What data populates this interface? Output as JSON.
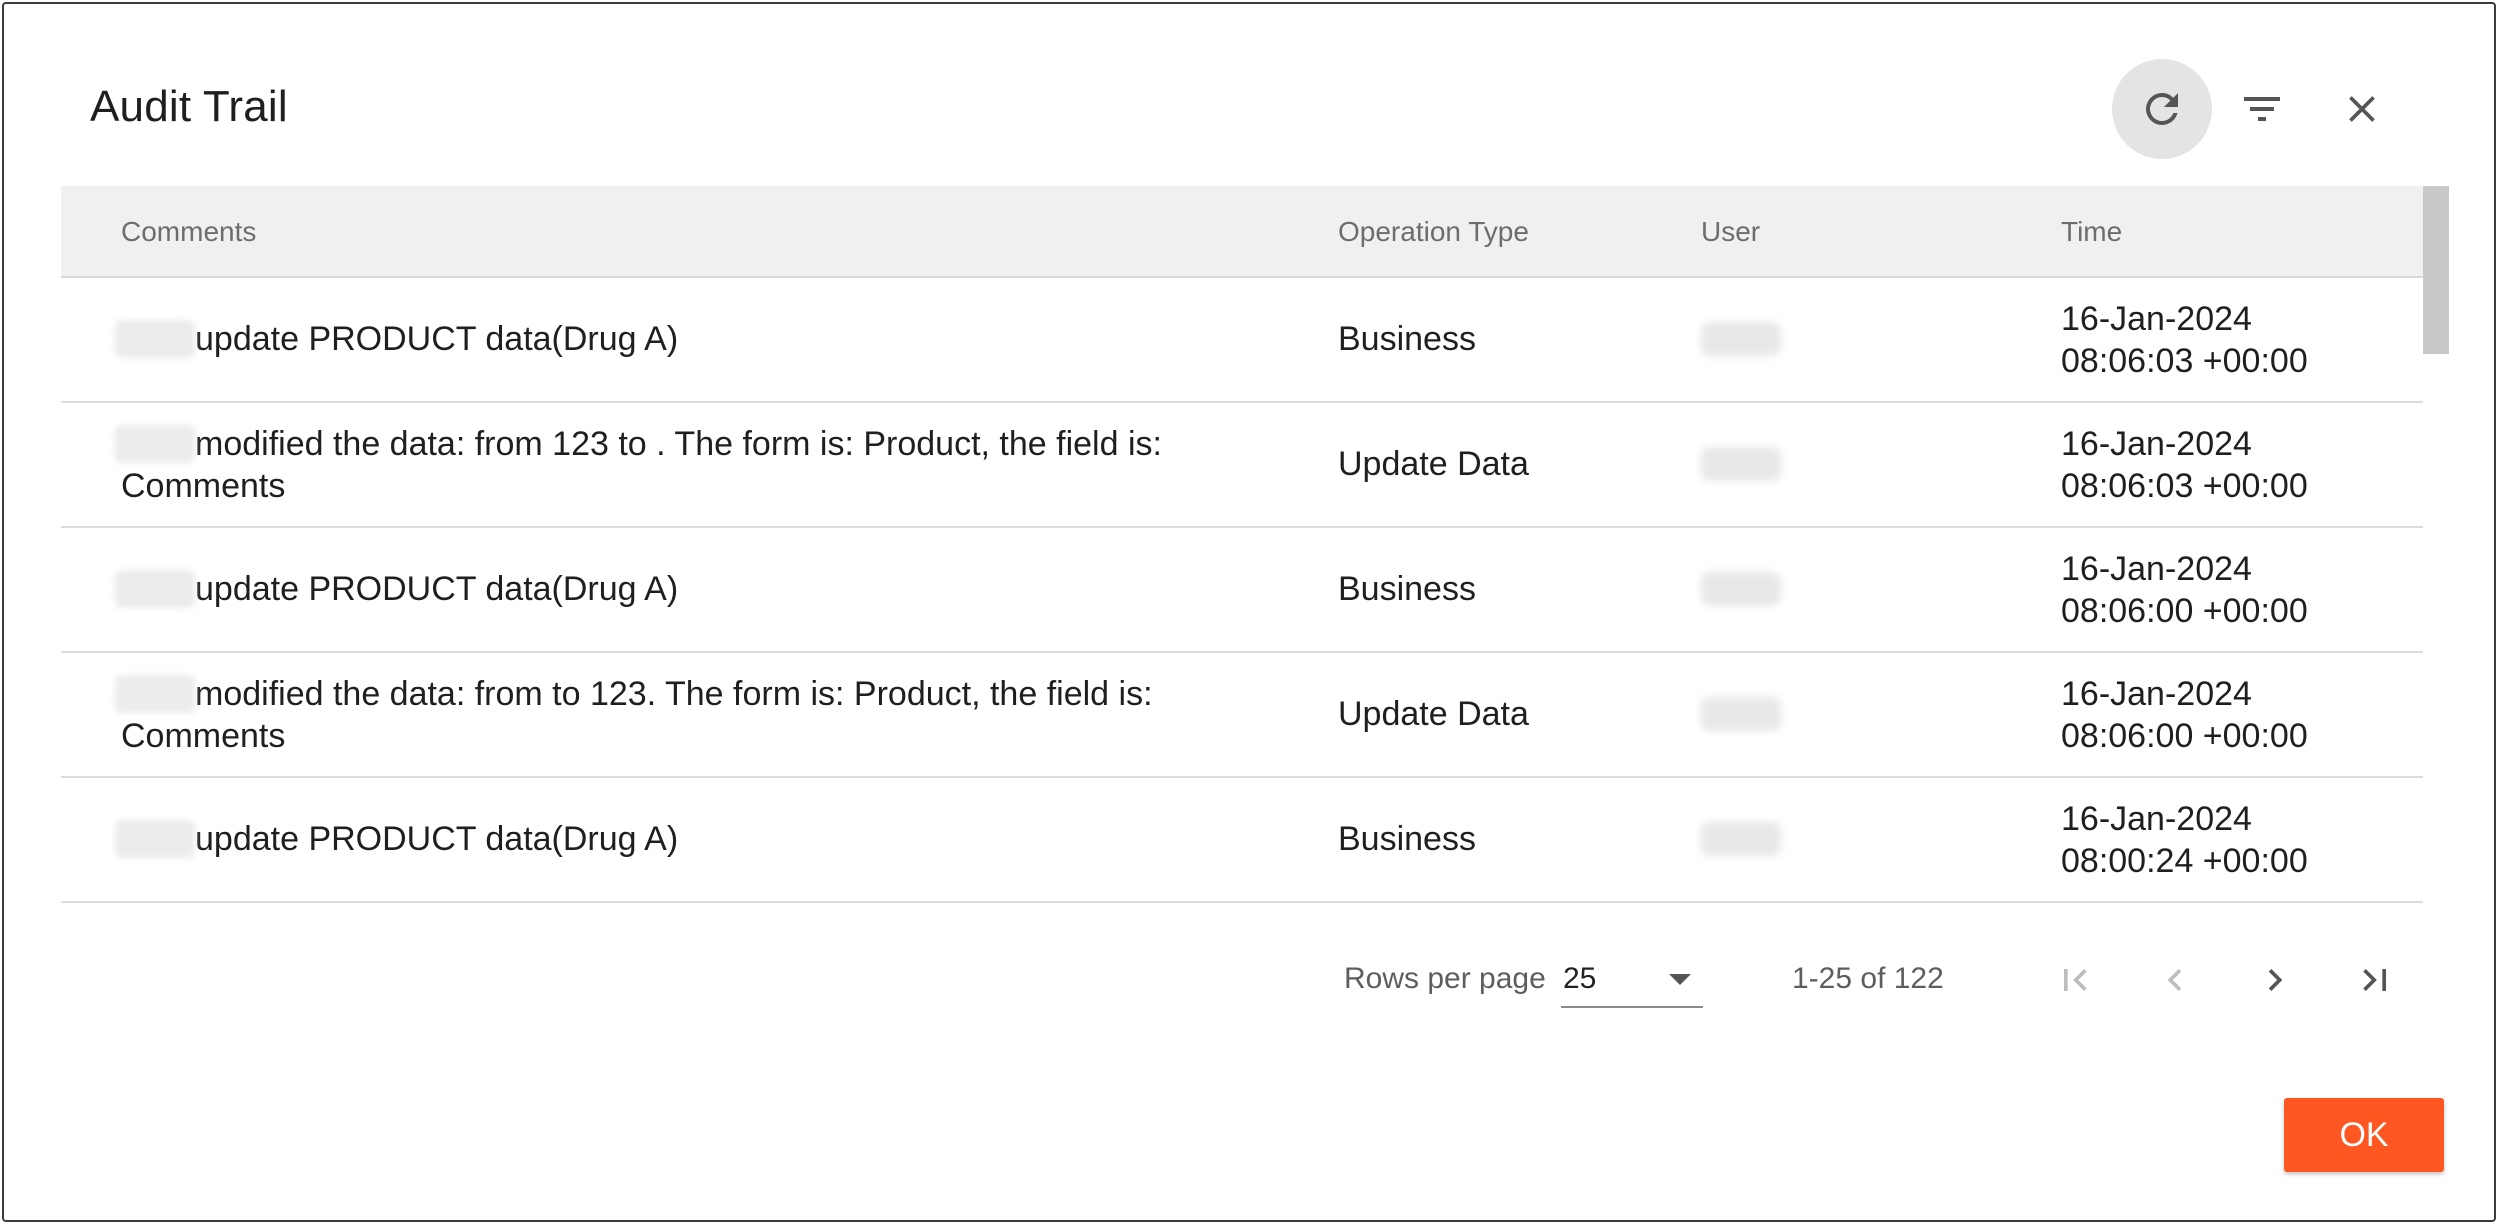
{
  "dialog": {
    "title": "Audit Trail",
    "toolbar": {
      "refresh_icon": "refresh-icon",
      "filter_icon": "filter-icon",
      "close_icon": "close-icon"
    }
  },
  "table": {
    "columns": [
      "Comments",
      "Operation Type",
      "User",
      "Time"
    ],
    "rows": [
      {
        "comment": "update PRODUCT data(Drug A)",
        "operation": "Business",
        "time_date": "16-Jan-2024",
        "time_clock": "08:06:03 +00:00"
      },
      {
        "comment": "modified the data: from 123 to . The form is: Product, the field is: Comments",
        "operation": "Update Data",
        "time_date": "16-Jan-2024",
        "time_clock": "08:06:03 +00:00"
      },
      {
        "comment": "update PRODUCT data(Drug A)",
        "operation": "Business",
        "time_date": "16-Jan-2024",
        "time_clock": "08:06:00 +00:00"
      },
      {
        "comment": "modified the data: from to 123. The form is: Product, the field is: Comments",
        "operation": "Update Data",
        "time_date": "16-Jan-2024",
        "time_clock": "08:06:00 +00:00"
      },
      {
        "comment": "update PRODUCT data(Drug A)",
        "operation": "Business",
        "time_date": "16-Jan-2024",
        "time_clock": "08:00:24 +00:00"
      }
    ]
  },
  "pagination": {
    "rows_per_page_label": "Rows per page",
    "rows_per_page_value": "25",
    "range_text": "1-25 of 122"
  },
  "footer": {
    "ok_label": "OK"
  },
  "colors": {
    "accent": "#ff5722",
    "header_bg": "#f0f0f0"
  }
}
